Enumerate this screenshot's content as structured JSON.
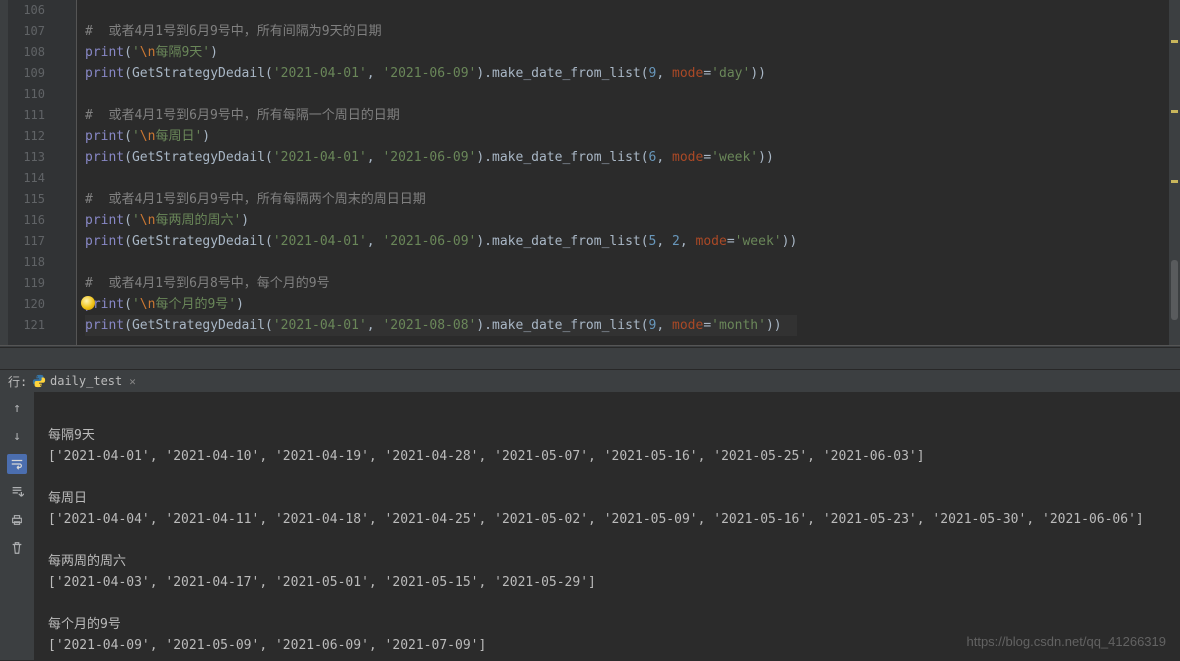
{
  "editor": {
    "lines": [
      {
        "num": "106",
        "tokens": []
      },
      {
        "num": "107",
        "tokens": [
          {
            "t": "#  或者4月1号到6月9号中，所有间隔为9天的日期",
            "c": "c-comment"
          }
        ]
      },
      {
        "num": "108",
        "tokens": [
          {
            "t": "print",
            "c": "c-builtin"
          },
          {
            "t": "(",
            "c": "c-paren"
          },
          {
            "t": "'",
            "c": "c-str"
          },
          {
            "t": "\\n",
            "c": "c-esc"
          },
          {
            "t": "每隔9天'",
            "c": "c-str"
          },
          {
            "t": ")",
            "c": "c-paren"
          }
        ]
      },
      {
        "num": "109",
        "tokens": [
          {
            "t": "print",
            "c": "c-builtin"
          },
          {
            "t": "(GetStrategyDedail(",
            "c": "c-plain"
          },
          {
            "t": "'2021-04-01'",
            "c": "c-str"
          },
          {
            "t": ", ",
            "c": "c-paren"
          },
          {
            "t": "'2021-06-09'",
            "c": "c-str"
          },
          {
            "t": ").make_date_from_list(",
            "c": "c-plain"
          },
          {
            "t": "9",
            "c": "c-num"
          },
          {
            "t": ", ",
            "c": "c-paren"
          },
          {
            "t": "mode",
            "c": "c-named"
          },
          {
            "t": "=",
            "c": "c-paren"
          },
          {
            "t": "'day'",
            "c": "c-str"
          },
          {
            "t": "))",
            "c": "c-paren"
          }
        ]
      },
      {
        "num": "110",
        "tokens": []
      },
      {
        "num": "111",
        "tokens": [
          {
            "t": "#  或者4月1号到6月9号中，所有每隔一个周日的日期",
            "c": "c-comment"
          }
        ]
      },
      {
        "num": "112",
        "tokens": [
          {
            "t": "print",
            "c": "c-builtin"
          },
          {
            "t": "(",
            "c": "c-paren"
          },
          {
            "t": "'",
            "c": "c-str"
          },
          {
            "t": "\\n",
            "c": "c-esc"
          },
          {
            "t": "每周日'",
            "c": "c-str"
          },
          {
            "t": ")",
            "c": "c-paren"
          }
        ]
      },
      {
        "num": "113",
        "tokens": [
          {
            "t": "print",
            "c": "c-builtin"
          },
          {
            "t": "(GetStrategyDedail(",
            "c": "c-plain"
          },
          {
            "t": "'2021-04-01'",
            "c": "c-str"
          },
          {
            "t": ", ",
            "c": "c-paren"
          },
          {
            "t": "'2021-06-09'",
            "c": "c-str"
          },
          {
            "t": ").make_date_from_list(",
            "c": "c-plain"
          },
          {
            "t": "6",
            "c": "c-num"
          },
          {
            "t": ", ",
            "c": "c-paren"
          },
          {
            "t": "mode",
            "c": "c-named"
          },
          {
            "t": "=",
            "c": "c-paren"
          },
          {
            "t": "'week'",
            "c": "c-str"
          },
          {
            "t": "))",
            "c": "c-paren"
          }
        ]
      },
      {
        "num": "114",
        "tokens": []
      },
      {
        "num": "115",
        "tokens": [
          {
            "t": "#  或者4月1号到6月9号中，所有每隔两个周末的周日日期",
            "c": "c-comment"
          }
        ]
      },
      {
        "num": "116",
        "tokens": [
          {
            "t": "print",
            "c": "c-builtin"
          },
          {
            "t": "(",
            "c": "c-paren"
          },
          {
            "t": "'",
            "c": "c-str"
          },
          {
            "t": "\\n",
            "c": "c-esc"
          },
          {
            "t": "每两周的周六'",
            "c": "c-str"
          },
          {
            "t": ")",
            "c": "c-paren"
          }
        ]
      },
      {
        "num": "117",
        "tokens": [
          {
            "t": "print",
            "c": "c-builtin"
          },
          {
            "t": "(GetStrategyDedail(",
            "c": "c-plain"
          },
          {
            "t": "'2021-04-01'",
            "c": "c-str"
          },
          {
            "t": ", ",
            "c": "c-paren"
          },
          {
            "t": "'2021-06-09'",
            "c": "c-str"
          },
          {
            "t": ").make_date_from_list(",
            "c": "c-plain"
          },
          {
            "t": "5",
            "c": "c-num"
          },
          {
            "t": ", ",
            "c": "c-paren"
          },
          {
            "t": "2",
            "c": "c-num"
          },
          {
            "t": ", ",
            "c": "c-paren"
          },
          {
            "t": "mode",
            "c": "c-named"
          },
          {
            "t": "=",
            "c": "c-paren"
          },
          {
            "t": "'week'",
            "c": "c-str"
          },
          {
            "t": "))",
            "c": "c-paren"
          }
        ]
      },
      {
        "num": "118",
        "tokens": []
      },
      {
        "num": "119",
        "tokens": [
          {
            "t": "#  或者4月1号到6月8号中，每个月的9号",
            "c": "c-comment"
          }
        ]
      },
      {
        "num": "120",
        "bulb": true,
        "tokens": [
          {
            "t": "print",
            "c": "c-builtin"
          },
          {
            "t": "(",
            "c": "c-paren"
          },
          {
            "t": "'",
            "c": "c-str"
          },
          {
            "t": "\\n",
            "c": "c-esc"
          },
          {
            "t": "每个月的9号'",
            "c": "c-str"
          },
          {
            "t": ")",
            "c": "c-paren"
          }
        ]
      },
      {
        "num": "121",
        "hl": true,
        "tokens": [
          {
            "t": "print",
            "c": "c-builtin"
          },
          {
            "t": "(GetStrategyDedail(",
            "c": "c-plain"
          },
          {
            "t": "'2021-04-01'",
            "c": "c-str"
          },
          {
            "t": ", ",
            "c": "c-paren"
          },
          {
            "t": "'2021-08-08'",
            "c": "c-str"
          },
          {
            "t": ").make_date_from_list(",
            "c": "c-plain"
          },
          {
            "t": "9",
            "c": "c-num"
          },
          {
            "t": ", ",
            "c": "c-paren"
          },
          {
            "t": "mode",
            "c": "c-named"
          },
          {
            "t": "=",
            "c": "c-paren"
          },
          {
            "t": "'month'",
            "c": "c-str"
          },
          {
            "t": "))",
            "c": "c-paren"
          }
        ]
      }
    ]
  },
  "run_tool": {
    "label": "行:",
    "tab_name": "daily_test"
  },
  "console": {
    "lines": [
      "",
      "每隔9天",
      "['2021-04-01', '2021-04-10', '2021-04-19', '2021-04-28', '2021-05-07', '2021-05-16', '2021-05-25', '2021-06-03']",
      "",
      "每周日",
      "['2021-04-04', '2021-04-11', '2021-04-18', '2021-04-25', '2021-05-02', '2021-05-09', '2021-05-16', '2021-05-23', '2021-05-30', '2021-06-06']",
      "",
      "每两周的周六",
      "['2021-04-03', '2021-04-17', '2021-05-01', '2021-05-15', '2021-05-29']",
      "",
      "每个月的9号",
      "['2021-04-09', '2021-05-09', '2021-06-09', '2021-07-09']"
    ]
  },
  "watermark": "https://blog.csdn.net/qq_41266319"
}
